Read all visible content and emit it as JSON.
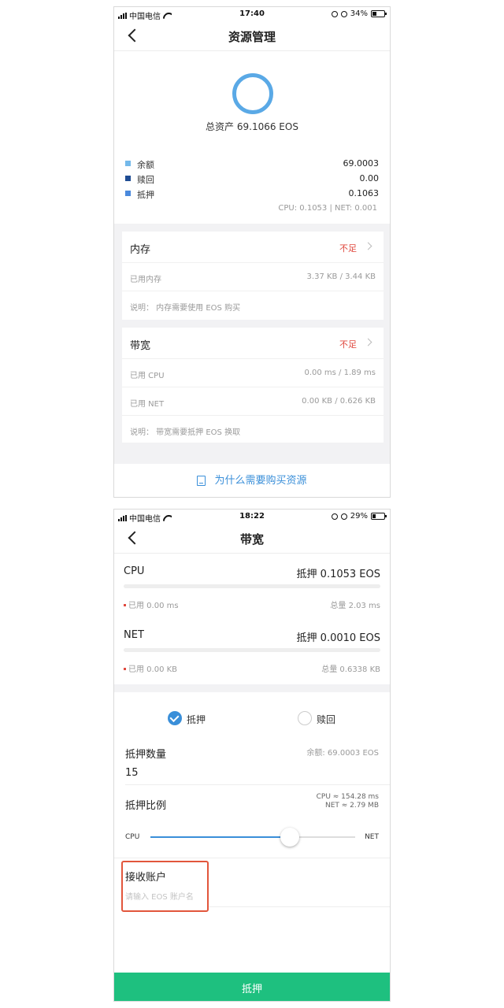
{
  "screen1": {
    "status": {
      "carrier": "中国电信",
      "time": "17:40",
      "battery": "34%",
      "battery_level": 0.34
    },
    "nav_title": "资源管理",
    "total_assets": "总资产 69.1066 EOS",
    "colors": {
      "balance": "#74b9ea",
      "redeem": "#1f4c93",
      "stake": "#4a89dc",
      "warning": "#e0483e",
      "link": "#3a8fd9"
    },
    "legend": [
      {
        "label": "余额",
        "value": "69.0003"
      },
      {
        "label": "赎回",
        "value": "0.00"
      },
      {
        "label": "抵押",
        "value": "0.1063"
      }
    ],
    "cpu_net": "CPU: 0.1053 | NET: 0.001",
    "memory": {
      "title": "内存",
      "status": "不足",
      "rows": [
        {
          "label": "已用内存",
          "value": "3.37 KB / 3.44 KB"
        }
      ],
      "note": "说明： 内存需要使用 EOS 购买"
    },
    "bandwidth": {
      "title": "带宽",
      "status": "不足",
      "rows": [
        {
          "label": "已用 CPU",
          "value": "0.00 ms / 1.89 ms"
        },
        {
          "label": "已用 NET",
          "value": "0.00 KB / 0.626 KB"
        }
      ],
      "note": "说明： 带宽需要抵押 EOS 换取"
    },
    "why_link": "为什么需要购买资源"
  },
  "screen2": {
    "status": {
      "carrier": "中国电信",
      "time": "18:22",
      "battery": "29%",
      "battery_level": 0.29
    },
    "nav_title": "带宽",
    "cpu": {
      "name": "CPU",
      "stake": "抵押 0.1053 EOS",
      "used": "已用 0.00 ms",
      "total": "总量 2.03 ms",
      "usage_fraction": 0
    },
    "net": {
      "name": "NET",
      "stake": "抵押 0.0010 EOS",
      "used": "已用 0.00 KB",
      "total": "总量 0.6338 KB",
      "usage_fraction": 0
    },
    "options": {
      "stake": "抵押",
      "redeem": "赎回",
      "selected": "stake"
    },
    "amount_label": "抵押数量",
    "balance": "余额: 69.0003 EOS",
    "amount_value": "15",
    "ratio_label": "抵押比例",
    "ratio_cpu": "CPU ≈ 154.28 ms",
    "ratio_net": "NET ≈ 2.79 MB",
    "slider": {
      "left_label": "CPU",
      "right_label": "NET",
      "value": 0.68
    },
    "receiver_label": "接收账户",
    "receiver_placeholder": "请输入 EOS 账户名",
    "submit_label": "抵押",
    "colors": {
      "accent": "#3a8fd9",
      "submit": "#1ec07f",
      "highlight": "#e2563c"
    }
  }
}
